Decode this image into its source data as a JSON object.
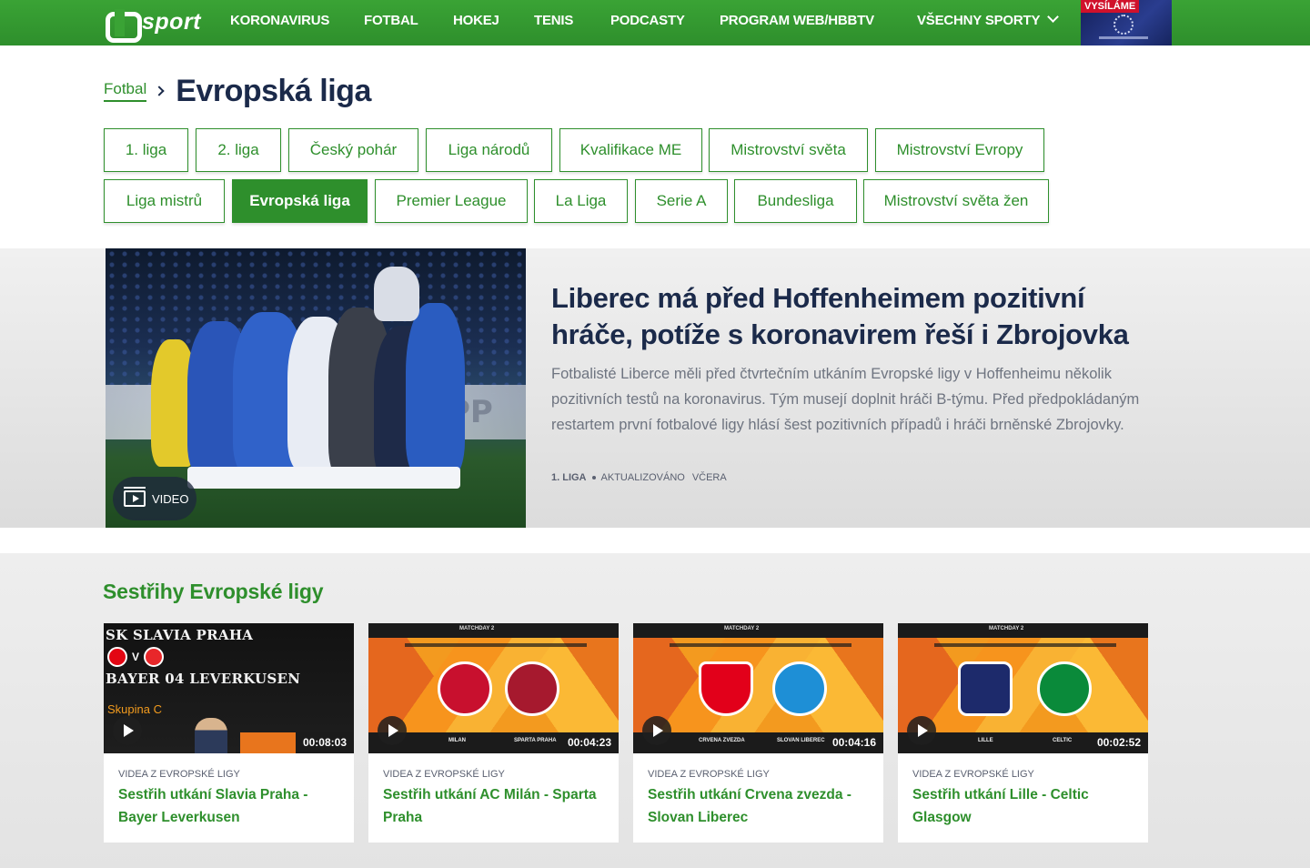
{
  "nav": {
    "logo_text": "sport",
    "items": [
      "KORONAVIRUS",
      "FOTBAL",
      "HOKEJ",
      "TENIS",
      "PODCASTY",
      "PROGRAM WEB/HBBTV",
      "VŠECHNY SPORTY"
    ],
    "live_label": "VYSÍLÁME",
    "accent": "#2e8f2c"
  },
  "breadcrumb": {
    "parent": "Fotbal",
    "title": "Evropská liga"
  },
  "tabs_row1": [
    "1. liga",
    "2. liga",
    "Český pohár",
    "Liga národů",
    "Kvalifikace ME",
    "Mistrovství světa",
    "Mistrovství Evropy"
  ],
  "tabs_row2": [
    "Liga mistrů",
    "Evropská liga",
    "Premier League",
    "La Liga",
    "Serie A",
    "Bundesliga",
    "Mistrovství světa žen"
  ],
  "active_tab": "Evropská liga",
  "hero": {
    "title": "Liberec má před Hoffenheimem pozitivní hráče, potíže s koronavirem řeší i Zbrojovka",
    "perex": "Fotbalisté Liberce měli před čtvrtečním utkáním Evropské ligy v Hoffenheimu několik pozitivních testů na koronavirus. Tým musejí doplnit hráči B-týmu. Před předpokládaným restartem první fotbalové ligy hlásí šest pozitivních případů i hráči brněnské Zbrojovky.",
    "category": "1. LIGA",
    "updated_label": "AKTUALIZOVÁNO",
    "updated_when": "VČERA",
    "video_label": "VIDEO",
    "image_text": "PP"
  },
  "section": {
    "title": "Sestřihy Evropské ligy",
    "cards": [
      {
        "category": "VIDEA Z EVROPSKÉ LIGY",
        "title": "Sestřih utkání Slavia Praha - Bayer Leverkusen",
        "duration": "00:08:03",
        "thumb_line1": "SK SLAVIA PRAHA",
        "thumb_v": "V",
        "thumb_line2": "BAYER 04 LEVERKUSEN",
        "thumb_group": "Skupina C"
      },
      {
        "category": "VIDEA Z EVROPSKÉ LIGY",
        "title": "Sestřih utkání AC Milán - Sparta Praha",
        "duration": "00:04:23",
        "matchday": "MATCHDAY 2",
        "home": "MILAN",
        "away": "SPARTA PRAHA",
        "home_color": "#c8102e",
        "away_color": "#a6192e"
      },
      {
        "category": "VIDEA Z EVROPSKÉ LIGY",
        "title": "Sestřih utkání Crvena zvezda - Slovan Liberec",
        "duration": "00:04:16",
        "matchday": "MATCHDAY 2",
        "home": "CRVENA ZVEZDA",
        "away": "SLOVAN LIBEREC",
        "home_color": "#e2001a",
        "away_color": "#1e8fd6"
      },
      {
        "category": "VIDEA Z EVROPSKÉ LIGY",
        "title": "Sestřih utkání Lille - Celtic Glasgow",
        "duration": "00:02:52",
        "matchday": "MATCHDAY 2",
        "home": "LILLE",
        "away": "CELTIC",
        "home_color": "#1d2a6b",
        "away_color": "#0a8a3a"
      }
    ]
  }
}
